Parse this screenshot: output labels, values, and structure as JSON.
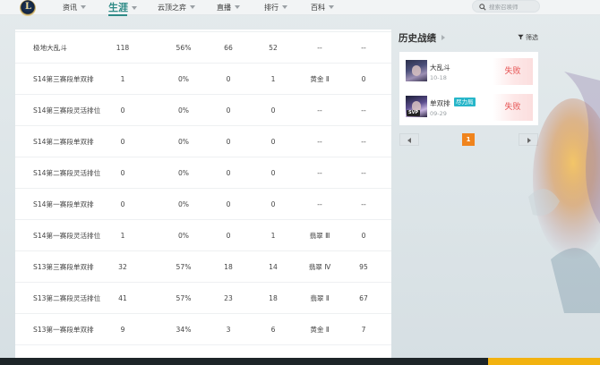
{
  "nav": {
    "items": [
      {
        "label": "资讯",
        "active": false
      },
      {
        "label": "生涯",
        "active": true
      },
      {
        "label": "云顶之弈",
        "active": false
      },
      {
        "label": "直播",
        "active": false
      },
      {
        "label": "排行",
        "active": false
      },
      {
        "label": "百科",
        "active": false
      }
    ],
    "search_placeholder": "搜索召唤师"
  },
  "stats_table": {
    "rows": [
      {
        "mode": "极地大乱斗",
        "c1": "118",
        "c2": "56%",
        "c3": "66",
        "c4": "52",
        "tier": "--",
        "c6": "--"
      },
      {
        "mode": "S14第三赛段单双排",
        "c1": "1",
        "c2": "0%",
        "c3": "0",
        "c4": "1",
        "tier": "黄金 Ⅱ",
        "c6": "0"
      },
      {
        "mode": "S14第三赛段灵活排位",
        "c1": "0",
        "c2": "0%",
        "c3": "0",
        "c4": "0",
        "tier": "--",
        "c6": "--"
      },
      {
        "mode": "S14第二赛段单双排",
        "c1": "0",
        "c2": "0%",
        "c3": "0",
        "c4": "0",
        "tier": "--",
        "c6": "--"
      },
      {
        "mode": "S14第二赛段灵活排位",
        "c1": "0",
        "c2": "0%",
        "c3": "0",
        "c4": "0",
        "tier": "--",
        "c6": "--"
      },
      {
        "mode": "S14第一赛段单双排",
        "c1": "0",
        "c2": "0%",
        "c3": "0",
        "c4": "0",
        "tier": "--",
        "c6": "--"
      },
      {
        "mode": "S14第一赛段灵活排位",
        "c1": "1",
        "c2": "0%",
        "c3": "0",
        "c4": "1",
        "tier": "翡翠 Ⅲ",
        "c6": "0"
      },
      {
        "mode": "S13第三赛段单双排",
        "c1": "32",
        "c2": "57%",
        "c3": "18",
        "c4": "14",
        "tier": "翡翠 Ⅳ",
        "c6": "95"
      },
      {
        "mode": "S13第二赛段灵活排位",
        "c1": "41",
        "c2": "57%",
        "c3": "23",
        "c4": "18",
        "tier": "翡翠 Ⅱ",
        "c6": "67"
      },
      {
        "mode": "S13第一赛段单双排",
        "c1": "9",
        "c2": "34%",
        "c3": "3",
        "c4": "6",
        "tier": "黄金 Ⅱ",
        "c6": "7"
      }
    ]
  },
  "history": {
    "title": "历史战绩",
    "filter_label": "筛选",
    "matches": [
      {
        "mode": "大乱斗",
        "date": "10-18",
        "tag": "",
        "result": "失败",
        "svp": ""
      },
      {
        "mode": "单双排",
        "date": "09-29",
        "tag": "尽力局",
        "result": "失败",
        "svp": "SVP"
      }
    ],
    "pager": {
      "current": "1"
    }
  },
  "colors": {
    "accent": "#2d8a86",
    "lose": "#e65252",
    "page_active": "#f0841d",
    "tag": "#27b6c9"
  }
}
